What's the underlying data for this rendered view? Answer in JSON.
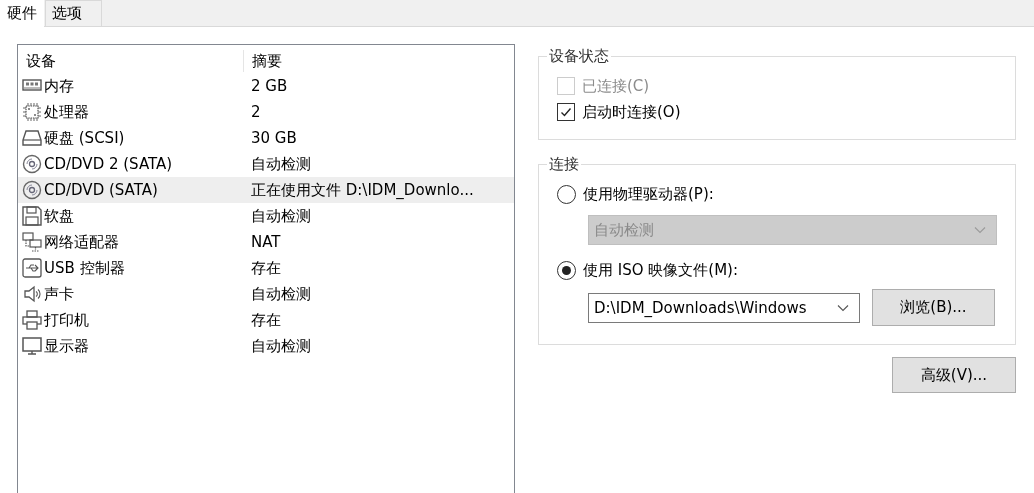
{
  "tabs": [
    {
      "label": "硬件",
      "selected": true
    },
    {
      "label": "选项",
      "selected": false
    }
  ],
  "device_list": {
    "columns": [
      "设备",
      "摘要"
    ],
    "rows": [
      {
        "kind": "memory",
        "device": "内存",
        "summary": "2 GB",
        "selected": false
      },
      {
        "kind": "processor",
        "device": "处理器",
        "summary": "2",
        "selected": false
      },
      {
        "kind": "disk",
        "device": "硬盘 (SCSI)",
        "summary": "30 GB",
        "selected": false
      },
      {
        "kind": "cd",
        "device": "CD/DVD 2 (SATA)",
        "summary": "自动检测",
        "selected": false
      },
      {
        "kind": "cd",
        "device": "CD/DVD (SATA)",
        "summary": "正在使用文件 D:\\IDM_Downlo...",
        "selected": true
      },
      {
        "kind": "floppy",
        "device": "软盘",
        "summary": "自动检测",
        "selected": false
      },
      {
        "kind": "network",
        "device": "网络适配器",
        "summary": "NAT",
        "selected": false
      },
      {
        "kind": "usb",
        "device": "USB 控制器",
        "summary": "存在",
        "selected": false
      },
      {
        "kind": "sound",
        "device": "声卡",
        "summary": "自动检测",
        "selected": false
      },
      {
        "kind": "printer",
        "device": "打印机",
        "summary": "存在",
        "selected": false
      },
      {
        "kind": "display",
        "device": "显示器",
        "summary": "自动检测",
        "selected": false
      }
    ]
  },
  "device_status": {
    "title": "设备状态",
    "options": [
      {
        "label": "已连接(C)",
        "checked": false,
        "disabled": true
      },
      {
        "label": "启动时连接(O)",
        "checked": true,
        "disabled": false
      }
    ]
  },
  "connection": {
    "title": "连接",
    "physical": {
      "label": "使用物理驱动器(P):",
      "selected": false,
      "dropdown": {
        "value": "自动检测",
        "disabled": true
      }
    },
    "iso": {
      "label": "使用 ISO 映像文件(M):",
      "selected": true,
      "path": "D:\\IDM_Downloads\\Windows",
      "browse_button": "浏览(B)..."
    }
  },
  "advanced_button": "高级(V)..."
}
